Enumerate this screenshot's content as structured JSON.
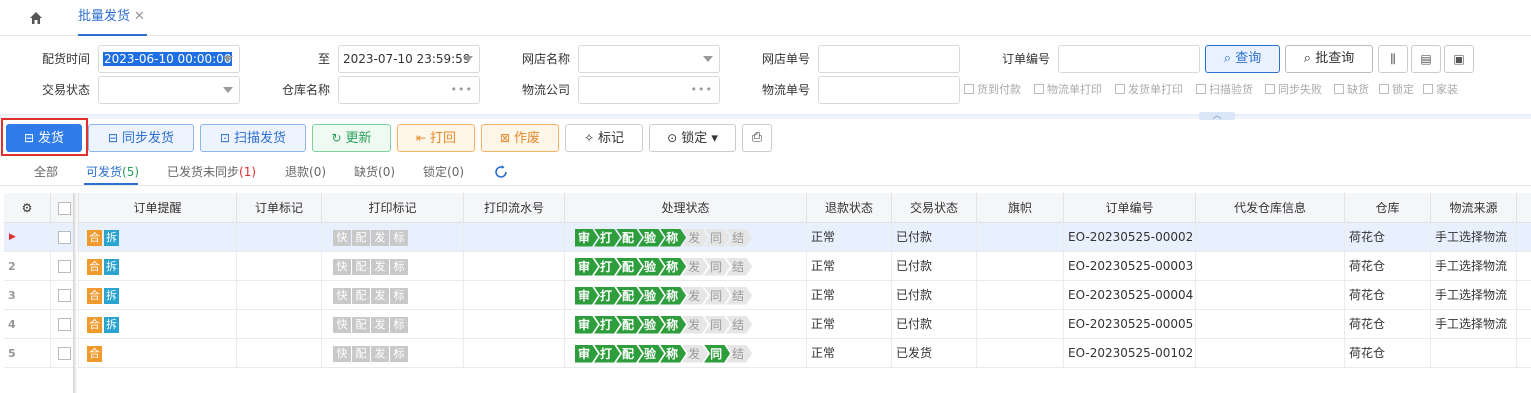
{
  "topbar": {
    "tab_label": "批量发货",
    "close": "✕"
  },
  "filters": {
    "dispatch_time_label": "配货时间",
    "dispatch_time_from": "2023-06-10 00:00:00",
    "to_label": "至",
    "dispatch_time_to": "2023-07-10 23:59:59",
    "shop_name_label": "网店名称",
    "shop_order_no_label": "网店单号",
    "order_no_label": "订单编号",
    "trade_status_label": "交易状态",
    "warehouse_label": "仓库名称",
    "logistics_company_label": "物流公司",
    "logistics_no_label": "物流单号",
    "query_label": "查询",
    "batch_query_label": "批查询",
    "checkboxes": [
      "货到付款",
      "物流单打印",
      "发货单打印",
      "扫描验货",
      "同步失败",
      "缺货",
      "锁定",
      "家装"
    ]
  },
  "actions": {
    "ship": "发货",
    "sync_ship": "同步发货",
    "scan_ship": "扫描发货",
    "update": "更新",
    "return": "打回",
    "void": "作废",
    "mark": "标记",
    "lock": "锁定"
  },
  "subtabs": [
    {
      "label": "全部",
      "count": ""
    },
    {
      "label": "可发货",
      "count": "(5)"
    },
    {
      "label": "已发货未同步",
      "count": "(1)"
    },
    {
      "label": "退款",
      "count": "(0)"
    },
    {
      "label": "缺货",
      "count": "(0)"
    },
    {
      "label": "锁定",
      "count": "(0)"
    }
  ],
  "table": {
    "headers": [
      "订单提醒",
      "订单标记",
      "打印标记",
      "打印流水号",
      "处理状态",
      "退款状态",
      "交易状态",
      "旗帜",
      "订单编号",
      "代发仓库信息",
      "仓库",
      "物流来源"
    ],
    "print_tags": [
      "快",
      "配",
      "发",
      "标"
    ],
    "rows": [
      {
        "num": "▶",
        "he": "合",
        "chai": "拆",
        "steps": [
          "审",
          "打",
          "配",
          "验",
          "称",
          "发",
          "同",
          "结"
        ],
        "refund": "正常",
        "trade": "已付款",
        "order_no": "EO-20230525-00002",
        "warehouse": "荷花仓",
        "logistics": "手工选择物流"
      },
      {
        "num": "2",
        "he": "合",
        "chai": "拆",
        "steps": [
          "审",
          "打",
          "配",
          "验",
          "称",
          "发",
          "同",
          "结"
        ],
        "refund": "正常",
        "trade": "已付款",
        "order_no": "EO-20230525-00003",
        "warehouse": "荷花仓",
        "logistics": "手工选择物流"
      },
      {
        "num": "3",
        "he": "合",
        "chai": "拆",
        "steps": [
          "审",
          "打",
          "配",
          "验",
          "称",
          "发",
          "同",
          "结"
        ],
        "refund": "正常",
        "trade": "已付款",
        "order_no": "EO-20230525-00004",
        "warehouse": "荷花仓",
        "logistics": "手工选择物流"
      },
      {
        "num": "4",
        "he": "合",
        "chai": "拆",
        "steps": [
          "审",
          "打",
          "配",
          "验",
          "称",
          "发",
          "同",
          "结"
        ],
        "refund": "正常",
        "trade": "已付款",
        "order_no": "EO-20230525-00005",
        "warehouse": "荷花仓",
        "logistics": "手工选择物流"
      },
      {
        "num": "5",
        "he": "合",
        "chai": "",
        "steps": [
          "审",
          "打",
          "配",
          "验",
          "称",
          "发",
          "同",
          "结"
        ],
        "refund": "正常",
        "trade": "已发货",
        "order_no": "EO-20230525-00102",
        "warehouse": "荷花仓",
        "logistics": ""
      }
    ],
    "step_on_counts": [
      5,
      5,
      5,
      5,
      5
    ],
    "row5_sync_on": true
  },
  "colors": {
    "primary": "#2f7bea",
    "step_on": "#2e9e3c",
    "he_tag": "#f09a2e",
    "chai_tag": "#2aa3cf",
    "highlight": "#e03131"
  }
}
